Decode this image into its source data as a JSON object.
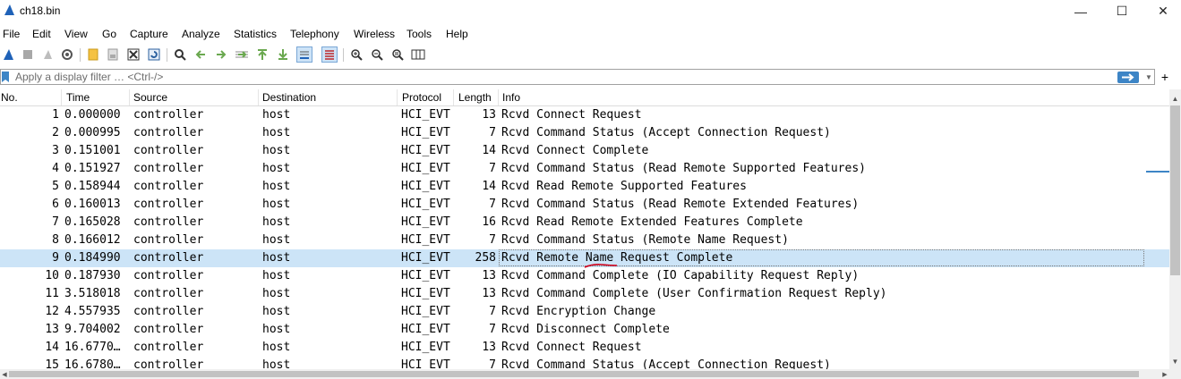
{
  "window": {
    "title": "ch18.bin",
    "minimize": "—",
    "maximize": "☐",
    "close": "✕"
  },
  "menu": [
    "File",
    "Edit",
    "View",
    "Go",
    "Capture",
    "Analyze",
    "Statistics",
    "Telephony",
    "Wireless",
    "Tools",
    "Help"
  ],
  "toolbar": {
    "icons": [
      "shark-fin-icon",
      "stop-icon",
      "restart-icon",
      "options-gear-icon",
      "open-file-icon",
      "save-file-icon",
      "close-file-icon",
      "reload-file-icon",
      "find-icon",
      "go-back-icon",
      "go-forward-icon",
      "go-to-packet-icon",
      "first-packet-icon",
      "last-packet-icon",
      "autoscroll-icon",
      "colorize-icon",
      "zoom-in-icon",
      "zoom-out-icon",
      "zoom-normal-icon",
      "resize-columns-icon"
    ]
  },
  "filter": {
    "placeholder": "Apply a display filter … <Ctrl-/>",
    "value": ""
  },
  "columns": {
    "no": "No.",
    "time": "Time",
    "source": "Source",
    "destination": "Destination",
    "protocol": "Protocol",
    "length": "Length",
    "info": "Info"
  },
  "packets": [
    {
      "no": "1",
      "time": "0.000000",
      "source": "controller",
      "destination": "host",
      "protocol": "HCI_EVT",
      "length": "13",
      "info": "Rcvd Connect Request"
    },
    {
      "no": "2",
      "time": "0.000995",
      "source": "controller",
      "destination": "host",
      "protocol": "HCI_EVT",
      "length": "7",
      "info": "Rcvd Command Status (Accept Connection Request)"
    },
    {
      "no": "3",
      "time": "0.151001",
      "source": "controller",
      "destination": "host",
      "protocol": "HCI_EVT",
      "length": "14",
      "info": "Rcvd Connect Complete"
    },
    {
      "no": "4",
      "time": "0.151927",
      "source": "controller",
      "destination": "host",
      "protocol": "HCI_EVT",
      "length": "7",
      "info": "Rcvd Command Status (Read Remote Supported Features)"
    },
    {
      "no": "5",
      "time": "0.158944",
      "source": "controller",
      "destination": "host",
      "protocol": "HCI_EVT",
      "length": "14",
      "info": "Rcvd Read Remote Supported Features"
    },
    {
      "no": "6",
      "time": "0.160013",
      "source": "controller",
      "destination": "host",
      "protocol": "HCI_EVT",
      "length": "7",
      "info": "Rcvd Command Status (Read Remote Extended Features)"
    },
    {
      "no": "7",
      "time": "0.165028",
      "source": "controller",
      "destination": "host",
      "protocol": "HCI_EVT",
      "length": "16",
      "info": "Rcvd Read Remote Extended Features Complete"
    },
    {
      "no": "8",
      "time": "0.166012",
      "source": "controller",
      "destination": "host",
      "protocol": "HCI_EVT",
      "length": "7",
      "info": "Rcvd Command Status (Remote Name Request)"
    },
    {
      "no": "9",
      "time": "0.184990",
      "source": "controller",
      "destination": "host",
      "protocol": "HCI_EVT",
      "length": "258",
      "info": "Rcvd Remote Name Request Complete",
      "selected": true
    },
    {
      "no": "10",
      "time": "0.187930",
      "source": "controller",
      "destination": "host",
      "protocol": "HCI_EVT",
      "length": "13",
      "info": "Rcvd Command Complete (IO Capability Request Reply)"
    },
    {
      "no": "11",
      "time": "3.518018",
      "source": "controller",
      "destination": "host",
      "protocol": "HCI_EVT",
      "length": "13",
      "info": "Rcvd Command Complete (User Confirmation Request Reply)"
    },
    {
      "no": "12",
      "time": "4.557935",
      "source": "controller",
      "destination": "host",
      "protocol": "HCI_EVT",
      "length": "7",
      "info": "Rcvd Encryption Change"
    },
    {
      "no": "13",
      "time": "9.704002",
      "source": "controller",
      "destination": "host",
      "protocol": "HCI_EVT",
      "length": "7",
      "info": "Rcvd Disconnect Complete"
    },
    {
      "no": "14",
      "time": "16.6770…",
      "source": "controller",
      "destination": "host",
      "protocol": "HCI_EVT",
      "length": "13",
      "info": "Rcvd Connect Request"
    },
    {
      "no": "15",
      "time": "16.6780…",
      "source": "controller",
      "destination": "host",
      "protocol": "HCI_EVT",
      "length": "7",
      "info": "Rcvd Command Status (Accept Connection Request)"
    }
  ],
  "colors": {
    "selected_row": "#cce4f7",
    "accent": "#3d85c6",
    "annotation": "#d0021b"
  }
}
